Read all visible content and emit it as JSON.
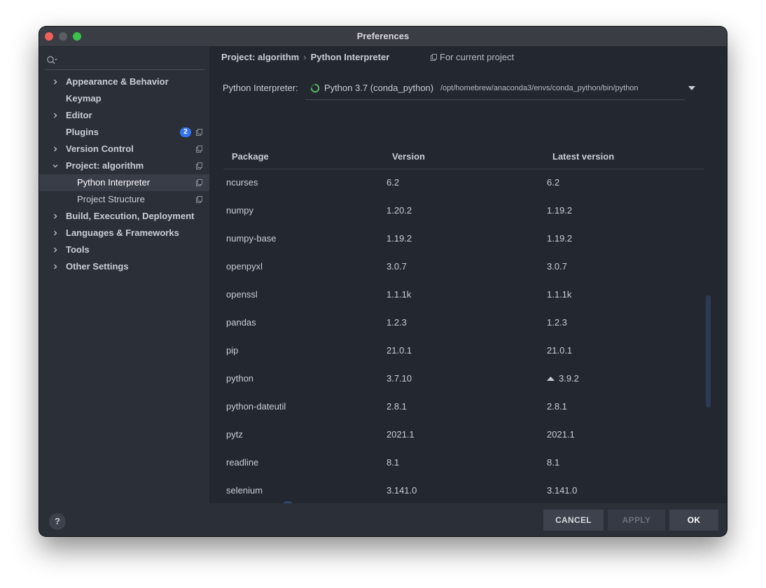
{
  "window": {
    "title": "Preferences"
  },
  "sidebar": {
    "search": {
      "value": ""
    },
    "items": [
      {
        "label": "Appearance & Behavior",
        "expanded": false
      },
      {
        "label": "Keymap"
      },
      {
        "label": "Editor",
        "expanded": false
      },
      {
        "label": "Plugins",
        "badge": "2"
      },
      {
        "label": "Version Control",
        "expanded": false
      },
      {
        "label": "Project: algorithm",
        "expanded": true
      },
      {
        "label": "Python Interpreter",
        "selected": true
      },
      {
        "label": "Project Structure"
      },
      {
        "label": "Build, Execution, Deployment",
        "expanded": false
      },
      {
        "label": "Languages & Frameworks",
        "expanded": false
      },
      {
        "label": "Tools",
        "expanded": false
      },
      {
        "label": "Other Settings",
        "expanded": false
      }
    ]
  },
  "main": {
    "breadcrumb": {
      "parent": "Project: algorithm",
      "current": "Python Interpreter"
    },
    "for_current_project": "For current project",
    "interpreter": {
      "label": "Python Interpreter:",
      "name": "Python 3.7 (conda_python)",
      "path": "/opt/homebrew/anaconda3/envs/conda_python/bin/python"
    },
    "table": {
      "headers": [
        "Package",
        "Version",
        "Latest version"
      ],
      "rows": [
        {
          "package": "ncurses",
          "version": "6.2",
          "latest": "6.2"
        },
        {
          "package": "numpy",
          "version": "1.20.2",
          "latest": "1.19.2"
        },
        {
          "package": "numpy-base",
          "version": "1.19.2",
          "latest": "1.19.2"
        },
        {
          "package": "openpyxl",
          "version": "3.0.7",
          "latest": "3.0.7"
        },
        {
          "package": "openssl",
          "version": "1.1.1k",
          "latest": "1.1.1k"
        },
        {
          "package": "pandas",
          "version": "1.2.3",
          "latest": "1.2.3"
        },
        {
          "package": "pip",
          "version": "21.0.1",
          "latest": "21.0.1"
        },
        {
          "package": "python",
          "version": "3.7.10",
          "latest": "3.9.2",
          "upgrade": true
        },
        {
          "package": "python-dateutil",
          "version": "2.8.1",
          "latest": "2.8.1"
        },
        {
          "package": "pytz",
          "version": "2021.1",
          "latest": "2021.1"
        },
        {
          "package": "readline",
          "version": "8.1",
          "latest": "8.1"
        },
        {
          "package": "selenium",
          "version": "3.141.0",
          "latest": "3.141.0"
        }
      ]
    }
  },
  "footer": {
    "help": "?",
    "cancel": "CANCEL",
    "apply": "APPLY",
    "ok": "OK"
  },
  "icons": {
    "toolbar": [
      "add-icon",
      "remove-icon",
      "upgrade-icon",
      "refresh-icon",
      "eye-icon"
    ]
  },
  "colors": {
    "accent": "#3574f0",
    "spinner": "#4caf50",
    "background": "#2b2f38"
  }
}
